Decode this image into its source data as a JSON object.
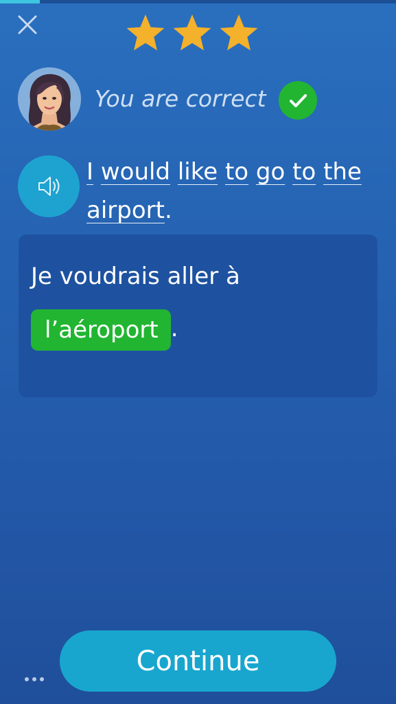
{
  "progress": {
    "fraction": 0.1
  },
  "header": {
    "close_icon": "close-icon",
    "stars_earned": 3,
    "stars_total": 3,
    "star_color": "#f4b12b"
  },
  "feedback": {
    "message": "You are correct",
    "status_icon": "checkmark-icon",
    "status_color": "#22b532"
  },
  "exercise": {
    "speaker_icon": "speaker-icon",
    "sentence_words": [
      "I",
      "would",
      "like",
      "to",
      "go",
      "to",
      "the",
      "airport"
    ],
    "sentence_punct": "."
  },
  "translation": {
    "prefix": "Je voudrais aller à",
    "answer": "l’aéroport",
    "suffix": ".",
    "answer_color": "#22b532"
  },
  "footer": {
    "continue_label": "Continue",
    "more_icon": "ellipsis-icon"
  }
}
